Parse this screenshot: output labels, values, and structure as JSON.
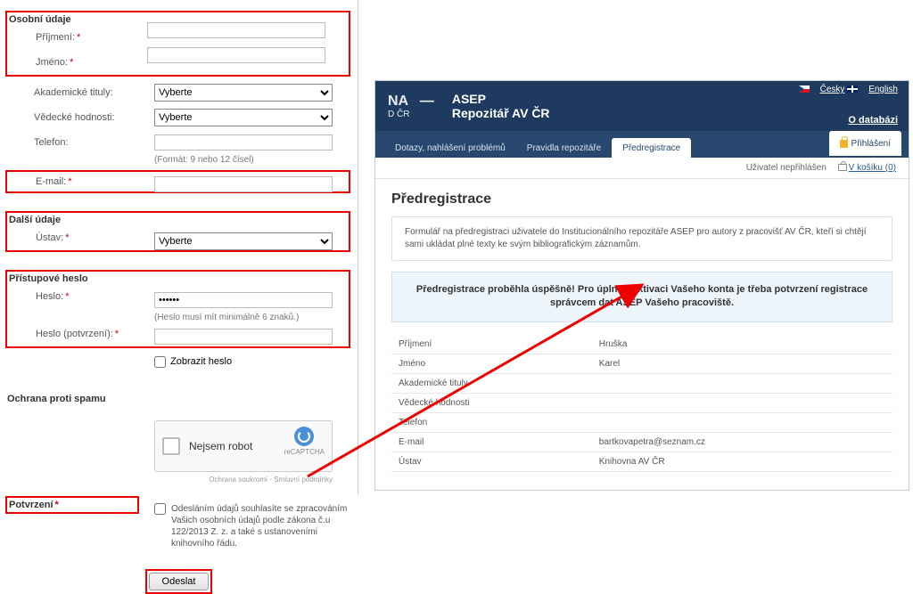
{
  "left": {
    "sections": {
      "personal": "Osobní údaje",
      "other": "Další údaje",
      "password": "Přístupové heslo",
      "spam": "Ochrana proti spamu",
      "confirm": "Potvrzení"
    },
    "labels": {
      "surname": "Příjmení:",
      "firstname": "Jméno:",
      "ac_titles": "Akademické tituly:",
      "sci_ranks": "Vědecké hodnosti:",
      "phone": "Telefon:",
      "phone_hint": "(Formát: 9 nebo 12 čísel)",
      "email": "E-mail:",
      "institute": "Ústav:",
      "password": "Heslo:",
      "password_hint": "(Heslo musí mít minimálně 6 znaků.)",
      "password_confirm": "Heslo (potvrzení):",
      "show_password": "Zobrazit heslo"
    },
    "select_placeholder": "Vyberte",
    "password_value": "••••••",
    "captcha": {
      "label": "Nejsem robot",
      "brand": "reCAPTCHA",
      "fine": "Ochrana soukromí - Smluvní podmínky"
    },
    "consent": "Odesláním údajů souhlasíte se zpracováním Vašich osobních údajů podle zákona č.u 122/2013 Z. z. a také s ustanoveními knihovního řádu.",
    "submit": "Odeslat"
  },
  "right": {
    "lang": {
      "cs": "Česky",
      "en": "English"
    },
    "header": {
      "left_main": "NA",
      "left_sub": "D ČR",
      "app": "ASEP",
      "subtitle": "Repozitář AV ČR",
      "db_link": "O databázi"
    },
    "tabs": {
      "t1": "Dotazy, nahlášení problémů",
      "t2": "Pravidla repozitáře",
      "t3": "Předregistrace",
      "login": "Přihlášení"
    },
    "user_bar": {
      "status": "Uživatel nepřihlášen",
      "cart": "V košíku (0)"
    },
    "page_title": "Předregistrace",
    "description": "Formulář na předregistraci uživatele do Institucionálního repozitáře ASEP pro autory z pracovišť AV ČR, kteří si chtějí sami ukládat plné texty ke svým bibliografickým záznamům.",
    "success": "Předregistrace proběhla úspěšně! Pro úplnou aktivaci Vašeho konta je třeba potvrzení registrace správcem dat ASEP Vašeho pracoviště.",
    "table": {
      "surname_l": "Příjmení",
      "surname_v": "Hruška",
      "firstname_l": "Jméno",
      "firstname_v": "Karel",
      "ac_l": "Akademické tituly",
      "ac_v": "",
      "sci_l": "Vědecké hodnosti",
      "sci_v": "",
      "phone_l": "Telefon",
      "phone_v": "",
      "email_l": "E-mail",
      "email_v": "bartkovapetra@seznam.cz",
      "inst_l": "Ústav",
      "inst_v": "Knihovna AV ČR"
    }
  }
}
